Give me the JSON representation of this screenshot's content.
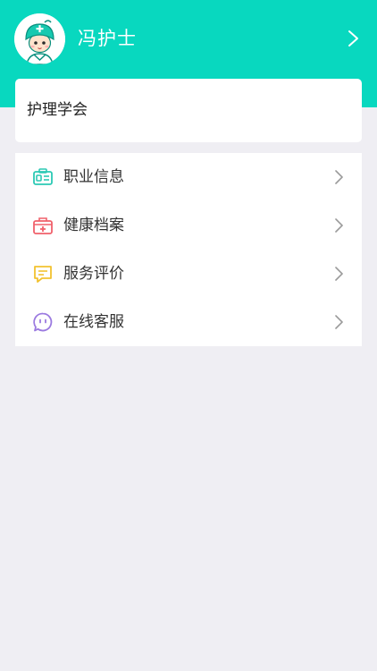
{
  "header": {
    "user_name": "冯护士",
    "avatar_icon": "nurse-avatar-icon",
    "chevron_icon": "chevron-right-icon"
  },
  "org_card": {
    "name": "护理学会"
  },
  "menu": {
    "items": [
      {
        "label": "职业信息",
        "icon": "id-card-icon",
        "color": "#2bc9b4"
      },
      {
        "label": "健康档案",
        "icon": "medical-kit-icon",
        "color": "#f0616b"
      },
      {
        "label": "服务评价",
        "icon": "comment-icon",
        "color": "#f2c230"
      },
      {
        "label": "在线客服",
        "icon": "chat-bubble-icon",
        "color": "#9b7ae0"
      }
    ]
  },
  "colors": {
    "header_bg": "#08d8bf",
    "page_bg": "#efeef3",
    "card_bg": "#ffffff"
  }
}
